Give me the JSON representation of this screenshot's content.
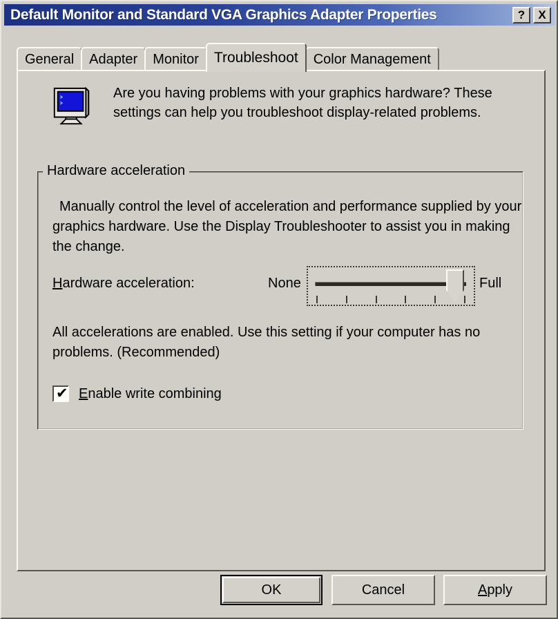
{
  "window": {
    "title": "Default Monitor and Standard VGA Graphics Adapter Properties",
    "help_button": "?",
    "close_button": "X"
  },
  "tabs": [
    {
      "label": "General",
      "active": false
    },
    {
      "label": "Adapter",
      "active": false
    },
    {
      "label": "Monitor",
      "active": false
    },
    {
      "label": "Troubleshoot",
      "active": true
    },
    {
      "label": "Color Management",
      "active": false
    }
  ],
  "intro": {
    "text": "Are you having problems with your graphics hardware? These settings can help you troubleshoot display-related problems.",
    "icon": "monitor-icon"
  },
  "hardware_acceleration": {
    "legend": "Hardware acceleration",
    "description": "Manually control the level of acceleration and performance supplied by your graphics hardware. Use the Display Troubleshooter to assist you in making the change.",
    "slider": {
      "label_prefix": "H",
      "label_rest": "ardware acceleration:",
      "min_label": "None",
      "max_label": "Full",
      "value": 6,
      "min": 1,
      "max": 6,
      "tick_count": 6
    },
    "status_text": "All accelerations are enabled. Use this setting if your computer has no problems. (Recommended)",
    "write_combining": {
      "label_prefix": "E",
      "label_rest": "nable write combining",
      "checked": true,
      "check_glyph": "✔"
    }
  },
  "footer": {
    "ok_label": "OK",
    "cancel_label": "Cancel",
    "apply_prefix": "A",
    "apply_rest": "pply"
  },
  "colors": {
    "face": "#d0cec6",
    "title_start": "#1d3282",
    "title_end": "#b6c4e2",
    "screen_blue": "#1414d8"
  }
}
